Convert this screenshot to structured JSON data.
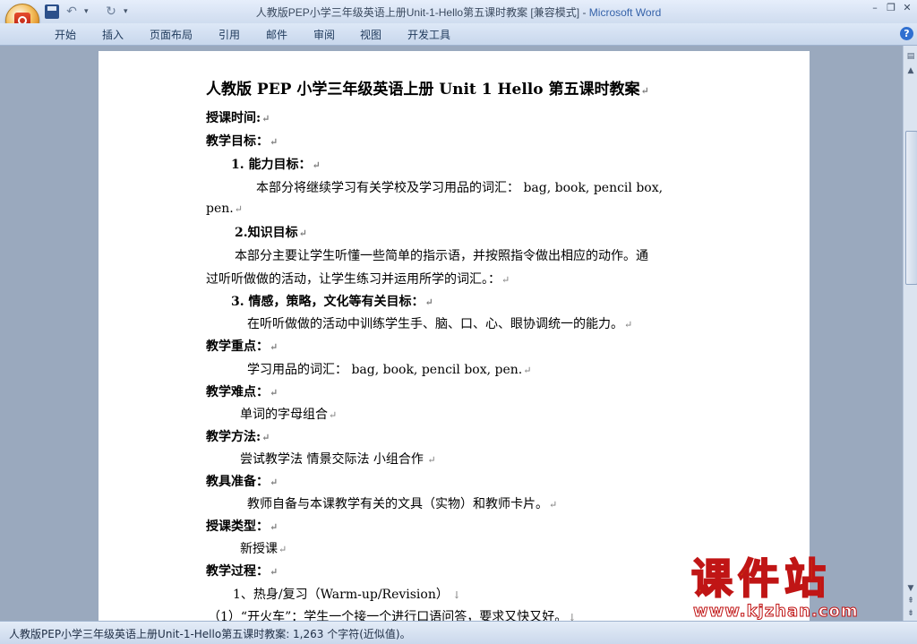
{
  "window": {
    "doc_title": "人教版PEP小学三年级英语上册Unit-1-Hello第五课时教案 [兼容模式]",
    "sep": " - ",
    "app_name": "Microsoft Word"
  },
  "quick_access": {
    "save_icon": "save-icon",
    "undo_icon": "undo-icon",
    "redo_icon": "redo-icon"
  },
  "window_controls": {
    "minimize": "–",
    "restore": "❐",
    "close": "✕"
  },
  "ribbon_tabs": [
    "开始",
    "插入",
    "页面布局",
    "引用",
    "邮件",
    "审阅",
    "视图",
    "开发工具"
  ],
  "help": "?",
  "document": {
    "title": "人教版 PEP 小学三年级英语上册 Unit 1 Hello 第五课时教案",
    "lines": [
      {
        "t": "授课时间:",
        "bold": true
      },
      {
        "t": "教学目标：",
        "bold": true
      },
      {
        "t": "1.  能力目标：",
        "bold": true
      },
      {
        "t": "本部分将继续学习有关学校及学习用品的词汇：  bag, book, pencil box,",
        "bold": false
      },
      {
        "t": "pen.",
        "bold": false
      },
      {
        "t": "2.知识目标",
        "bold": true
      },
      {
        "t": "本部分主要让学生听懂一些简单的指示语，并按照指令做出相应的动作。通",
        "bold": false
      },
      {
        "t": "过听听做做的活动，让学生练习并运用所学的词汇。：",
        "bold": false
      },
      {
        "t": "3.  情感，策略，文化等有关目标：",
        "bold": true
      },
      {
        "t": "在听听做做的活动中训练学生手、脑、口、心、眼协调统一的能力。",
        "bold": false
      },
      {
        "t": "教学重点：",
        "bold": true
      },
      {
        "t": "学习用品的词汇：  bag,  book,  pencil  box,  pen.",
        "bold": false
      },
      {
        "t": "教学难点：",
        "bold": true
      },
      {
        "t": "单词的字母组合",
        "bold": false
      },
      {
        "t": "教学方法:",
        "bold": true
      },
      {
        "t": "尝试教学法  情景交际法    小组合作",
        "bold": false
      },
      {
        "t": "教具准备：",
        "bold": true
      },
      {
        "t": "教师自备与本课教学有关的文具（实物）和教师卡片。",
        "bold": false
      },
      {
        "t": "授课类型：",
        "bold": true
      },
      {
        "t": "新授课",
        "bold": false
      },
      {
        "t": "教学过程：",
        "bold": true
      },
      {
        "t": "1、热身/复习（Warm-up/Revision）",
        "bold": false
      },
      {
        "t": "（1）“开火车”：学生一个接一个进行口语问答，要求又快又好。",
        "bold": false
      }
    ]
  },
  "status_bar": "人教版PEP小学三年级英语上册Unit-1-Hello第五课时教案: 1,263 个字符(近似值)。",
  "watermark": {
    "text": "课件站",
    "url": "www.kjzhan.com"
  },
  "colors": {
    "title_app": "#3562a9",
    "watermark_fill": "#f5d400",
    "watermark_stroke": "#c01515"
  }
}
